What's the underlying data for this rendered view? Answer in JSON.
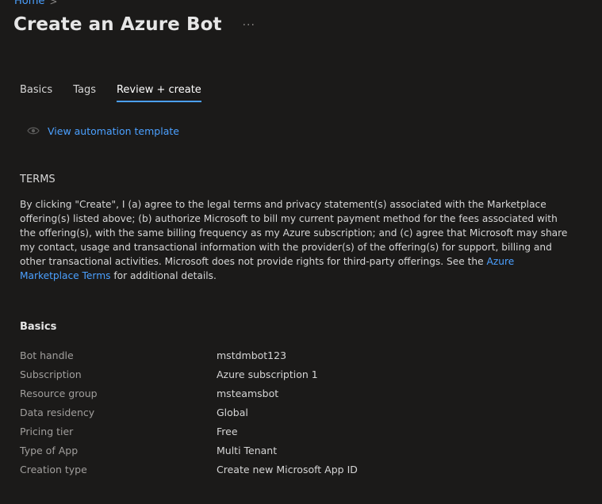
{
  "breadcrumb": {
    "home": "Home",
    "separator": ">"
  },
  "header": {
    "title": "Create an Azure Bot",
    "more": "..."
  },
  "tabs": [
    {
      "label": "Basics",
      "active": false
    },
    {
      "label": "Tags",
      "active": false
    },
    {
      "label": "Review + create",
      "active": true
    }
  ],
  "automation": {
    "link_label": "View automation template",
    "icon": "eye-icon"
  },
  "terms": {
    "heading": "TERMS",
    "text_part1": "By clicking \"Create\", I (a) agree to the legal terms and privacy statement(s) associated with the Marketplace offering(s) listed above; (b) authorize Microsoft to bill my current payment method for the fees associated with the offering(s), with the same billing frequency as my Azure subscription; and (c) agree that Microsoft may share my contact, usage and transactional information with the provider(s) of the offering(s) for support, billing and other transactional activities. Microsoft does not provide rights for third-party offerings. See the ",
    "link": "Azure Marketplace Terms",
    "text_part2": " for additional details."
  },
  "basics": {
    "heading": "Basics",
    "rows": [
      {
        "label": "Bot handle",
        "value": "mstdmbot123"
      },
      {
        "label": "Subscription",
        "value": "Azure subscription 1"
      },
      {
        "label": "Resource group",
        "value": "msteamsbot"
      },
      {
        "label": "Data residency",
        "value": "Global"
      },
      {
        "label": "Pricing tier",
        "value": "Free"
      },
      {
        "label": "Type of App",
        "value": "Multi Tenant"
      },
      {
        "label": "Creation type",
        "value": "Create new Microsoft App ID"
      }
    ]
  },
  "colors": {
    "background": "#1b1a19",
    "accent": "#4ba0ff",
    "text": "#d6d6d6",
    "label": "#a19f9d"
  }
}
